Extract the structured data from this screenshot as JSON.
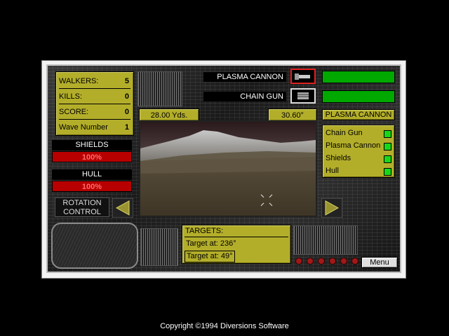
{
  "stats": {
    "walkers_label": "WALKERS:",
    "walkers_value": "5",
    "kills_label": "KILLS:",
    "kills_value": "0",
    "score_label": "SCORE:",
    "score_value": "0",
    "wave_label": "Wave Number",
    "wave_value": "1"
  },
  "shields": {
    "label": "SHIELDS",
    "value": "100%",
    "level": 1.0
  },
  "hull": {
    "label": "HULL",
    "value": "100%",
    "level": 1.0
  },
  "weapons": {
    "primary": "PLASMA CANNON",
    "secondary": "CHAIN GUN",
    "primary_icon": "plasma-cannon-icon",
    "secondary_icon": "chain-gun-icon",
    "selected": "PLASMA CANNON"
  },
  "viewport": {
    "range": "28.00 Yds.",
    "heading": "30.60°"
  },
  "systems": [
    {
      "label": "Chain Gun",
      "status": "ok"
    },
    {
      "label": "Plasma Cannon",
      "status": "ok"
    },
    {
      "label": "Shields",
      "status": "ok"
    },
    {
      "label": "Hull",
      "status": "ok"
    }
  ],
  "rotation_control": {
    "line1": "ROTATION",
    "line2": "CONTROL"
  },
  "targets": {
    "header": "TARGETS:",
    "items": [
      "Target at:  236°",
      "Target at:  49°"
    ]
  },
  "menu_label": "Menu",
  "copyright": "Copyright ©1994 Diversions Software",
  "colors": {
    "panel_olive": "#b3ae2a",
    "status_red": "#b80000",
    "status_green": "#00a800"
  }
}
